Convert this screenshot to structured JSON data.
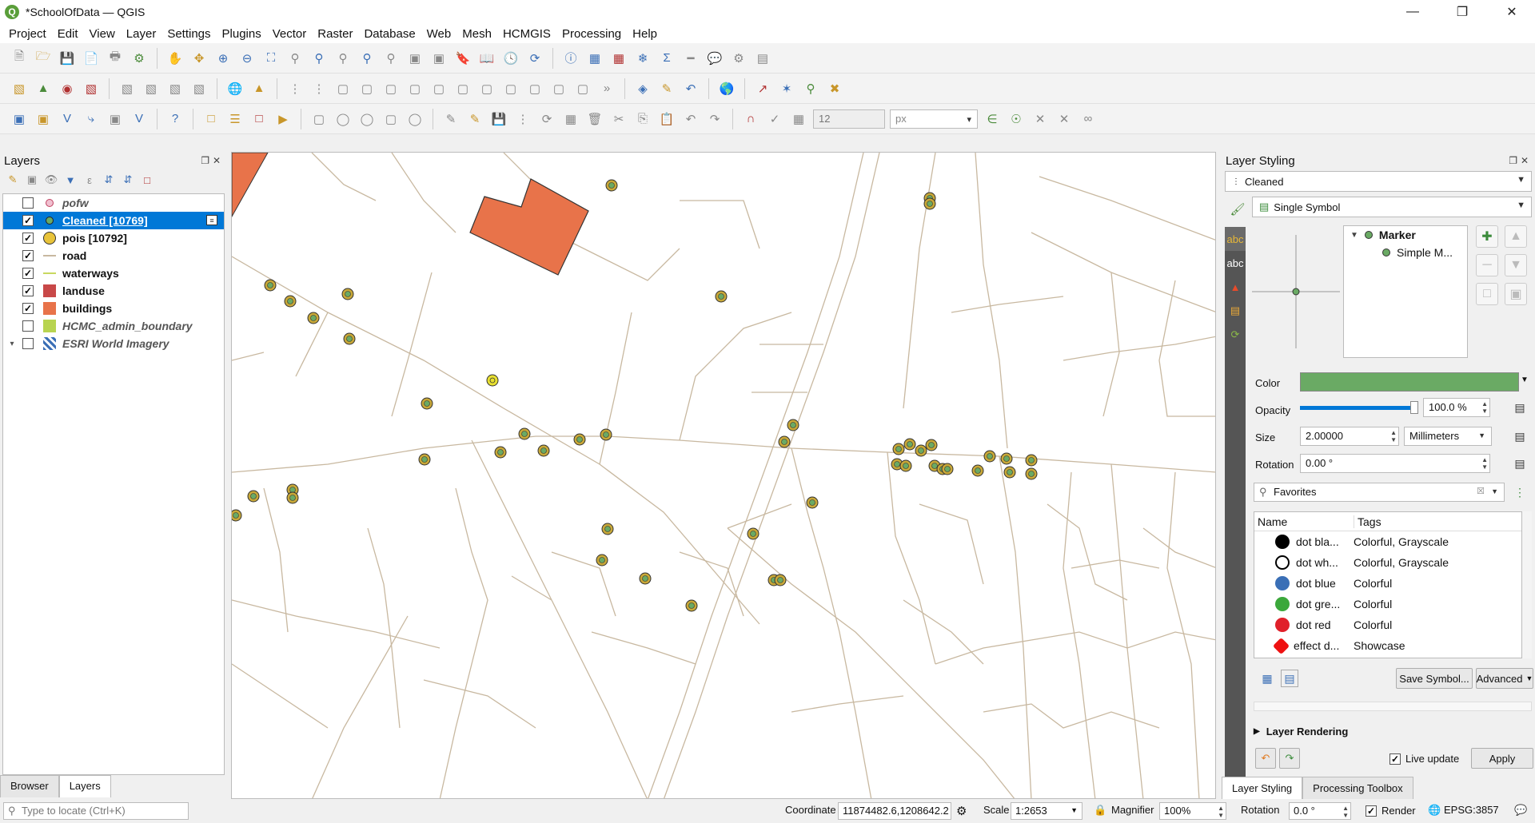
{
  "window": {
    "title": "*SchoolOfData — QGIS",
    "app_icon": "qgis-icon"
  },
  "menu": [
    "Project",
    "Edit",
    "View",
    "Layer",
    "Settings",
    "Plugins",
    "Vector",
    "Raster",
    "Database",
    "Web",
    "Mesh",
    "HCMGIS",
    "Processing",
    "Help"
  ],
  "toolbar3": {
    "size_value": "12",
    "unit_value": "px"
  },
  "layers_panel": {
    "title": "Layers",
    "layers": [
      {
        "name": "pofw",
        "checked": false,
        "symbol": "point-pink",
        "italic": true
      },
      {
        "name": "Cleaned [10769]",
        "checked": true,
        "symbol": "point-green",
        "selected": true
      },
      {
        "name": "pois [10792]",
        "checked": true,
        "symbol": "point-yellow"
      },
      {
        "name": "road",
        "checked": true,
        "symbol": "line-tan"
      },
      {
        "name": "waterways",
        "checked": true,
        "symbol": "line-yellowgreen"
      },
      {
        "name": "landuse",
        "checked": true,
        "symbol": "fill-red"
      },
      {
        "name": "buildings",
        "checked": true,
        "symbol": "fill-orange"
      },
      {
        "name": "HCMC_admin_boundary",
        "checked": false,
        "symbol": "fill-lime",
        "italic": true
      },
      {
        "name": "ESRI World Imagery",
        "checked": false,
        "symbol": "raster-icon",
        "italic": true,
        "expandable": true
      }
    ],
    "tabs": [
      "Browser",
      "Layers"
    ],
    "active_tab": "Layers"
  },
  "styling_panel": {
    "title": "Layer Styling",
    "layer_select": "Cleaned",
    "renderer": "Single Symbol",
    "tree": {
      "root": "Marker",
      "child": "Simple M..."
    },
    "color_label": "Color",
    "color_value": "#6aaa64",
    "opacity_label": "Opacity",
    "opacity_value": "100.0 %",
    "opacity_fraction": 1.0,
    "size_label": "Size",
    "size_value": "2.00000",
    "size_unit": "Millimeters",
    "rotation_label": "Rotation",
    "rotation_value": "0.00 °",
    "search_value": "Favorites",
    "list_headers": {
      "name": "Name",
      "tags": "Tags"
    },
    "symbols": [
      {
        "name": "dot  bla...",
        "tags": "Colorful, Grayscale",
        "color": "#000000",
        "style": "solid"
      },
      {
        "name": "dot  wh...",
        "tags": "Colorful, Grayscale",
        "color": "#ffffff",
        "style": "outline"
      },
      {
        "name": "dot blue",
        "tags": "Colorful",
        "color": "#3a6fb6",
        "style": "solid"
      },
      {
        "name": "dot gre...",
        "tags": "Colorful",
        "color": "#3ba83b",
        "style": "solid"
      },
      {
        "name": "dot red",
        "tags": "Colorful",
        "color": "#e0202a",
        "style": "solid"
      },
      {
        "name": "effect d...",
        "tags": "Showcase",
        "color": "#ee1111",
        "style": "burst"
      }
    ],
    "save_symbol": "Save Symbol...",
    "advanced": "Advanced",
    "layer_rendering": "Layer Rendering",
    "live_update": "Live update",
    "live_update_checked": true,
    "apply": "Apply",
    "bottom_tabs": [
      "Layer Styling",
      "Processing Toolbox"
    ],
    "active_bottom_tab": "Layer Styling"
  },
  "statusbar": {
    "locate_placeholder": "Type to locate (Ctrl+K)",
    "coordinate_label": "Coordinate",
    "coordinate_value": "11874482.6,1208642.2",
    "scale_label": "Scale",
    "scale_value": "1:2653",
    "magnifier_label": "Magnifier",
    "magnifier_value": "100%",
    "rotation_label": "Rotation",
    "rotation_value": "0.0 °",
    "render_label": "Render",
    "render_checked": true,
    "crs": "EPSG:3857"
  },
  "colors": {
    "road": "#c8b8a0",
    "building_fill": "#e8734a",
    "poi_outer": "#c8a838",
    "poi_inner": "#6aaa64",
    "selection": "#0078d7"
  }
}
